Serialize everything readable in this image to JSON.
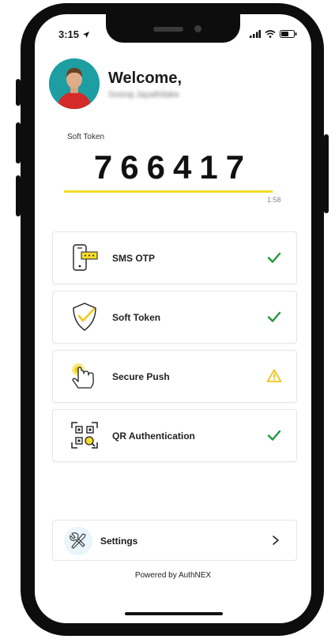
{
  "status": {
    "time": "3:15"
  },
  "user": {
    "welcome": "Welcome,",
    "name": "Sooraj Jayathilake"
  },
  "token": {
    "label": "Soft Token",
    "code": "766417",
    "timer": "1:58",
    "progress": 0.93
  },
  "methods": [
    {
      "label": "SMS OTP",
      "icon": "phone-sms-icon",
      "status": "check-icon"
    },
    {
      "label": "Soft Token",
      "icon": "shield-check-icon",
      "status": "check-icon"
    },
    {
      "label": "Secure Push",
      "icon": "tap-hand-icon",
      "status": "warning-icon"
    },
    {
      "label": "QR Authentication",
      "icon": "qr-code-icon",
      "status": "check-icon"
    }
  ],
  "settings": {
    "label": "Settings"
  },
  "footer": {
    "powered": "Powered by AuthNEX"
  },
  "colors": {
    "accent": "#f2dc2a",
    "success": "#1e9a3c",
    "warning": "#f0c419"
  }
}
